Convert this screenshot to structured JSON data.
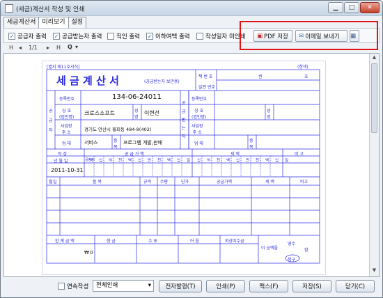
{
  "window": {
    "title": "(세금)계산서 작성 및 인쇄"
  },
  "tabs": [
    {
      "label": "세금계산서"
    },
    {
      "label": "미리보기"
    },
    {
      "label": "설정"
    }
  ],
  "toolbar": {
    "checkboxes": [
      {
        "label": "공급자 출력",
        "checked": true
      },
      {
        "label": "공급받는자 출력",
        "checked": true
      },
      {
        "label": "직인 출력",
        "checked": false
      },
      {
        "label": "이하여백 출력",
        "checked": true
      },
      {
        "label": "작성일자 미인쇄",
        "checked": false
      }
    ],
    "pdf_label": "PDF 저장",
    "email_label": "이메일 보내기"
  },
  "nav": {
    "page": "1/1",
    "first": "H",
    "prev": "◂",
    "next": "▸",
    "last": "H",
    "zoom": "Q"
  },
  "invoice": {
    "form_no": "[별지 제11호서식]",
    "copy_label": "(청색)",
    "title": "세 금 계 산 서",
    "subtitle": "(공급받는자 보관용)",
    "book_no_label": "책 번 호",
    "gwon": "권",
    "ho": "호",
    "serial_label": "일련 번호",
    "reg_no_label": "등록번호",
    "supplier_reg_no": "134-06-24011",
    "supplier_side": "공급자",
    "buyer_side": "공급받는자",
    "company_label": "상 호\n(법인명)",
    "name_label": "성명",
    "supplier_company": "크로스소프트",
    "supplier_name": "이현선",
    "address_label": "사업장\n주 소",
    "supplier_address": "경기도 안산시 월피동 484-8(402)",
    "business_type_label": "업 태",
    "supplier_business_type": "서비스",
    "item_label": "종목",
    "supplier_item": "프로그램 개발,판매",
    "date_header": "작 성",
    "supply_amount_header": "공 급 가 액",
    "tax_header": "세 액",
    "note_header": "비 고",
    "ymd_label": "년 월 일",
    "blank_count_label": "공란수",
    "digits": [
      "백",
      "십",
      "억",
      "천",
      "백",
      "십",
      "만",
      "천",
      "백",
      "십",
      "일"
    ],
    "issue_date": "2011-10-31",
    "col_month": "월",
    "col_day": "일",
    "col_item": "품 목",
    "col_spec": "규격",
    "col_qty": "수량",
    "col_price": "단가",
    "col_supply": "공급가액",
    "col_tax": "세 액",
    "col_note": "비고",
    "total_label": "합 계 금 액",
    "cash_label": "현 금",
    "check_label": "수 표",
    "note_bill_label": "어 음",
    "credit_label": "외상미수금",
    "this_amount_label": "이 금액을",
    "receipt_label": "영수",
    "claim_label": "청구",
    "ham_label": "함",
    "won_sign": "₩",
    "total_zero": "0"
  },
  "bottom": {
    "continuous_label": "연속작성",
    "continuous_checked": false,
    "print_mode": "전체인쇄",
    "issue_button": "전자발행(T)",
    "print_button": "인쇄(P)",
    "fax_button": "팩스(F)",
    "save_button": "저장(S)",
    "close_button": "닫기(C)"
  },
  "colors": {
    "form_blue": "#2b2be0",
    "highlight_red": "#e01414"
  }
}
